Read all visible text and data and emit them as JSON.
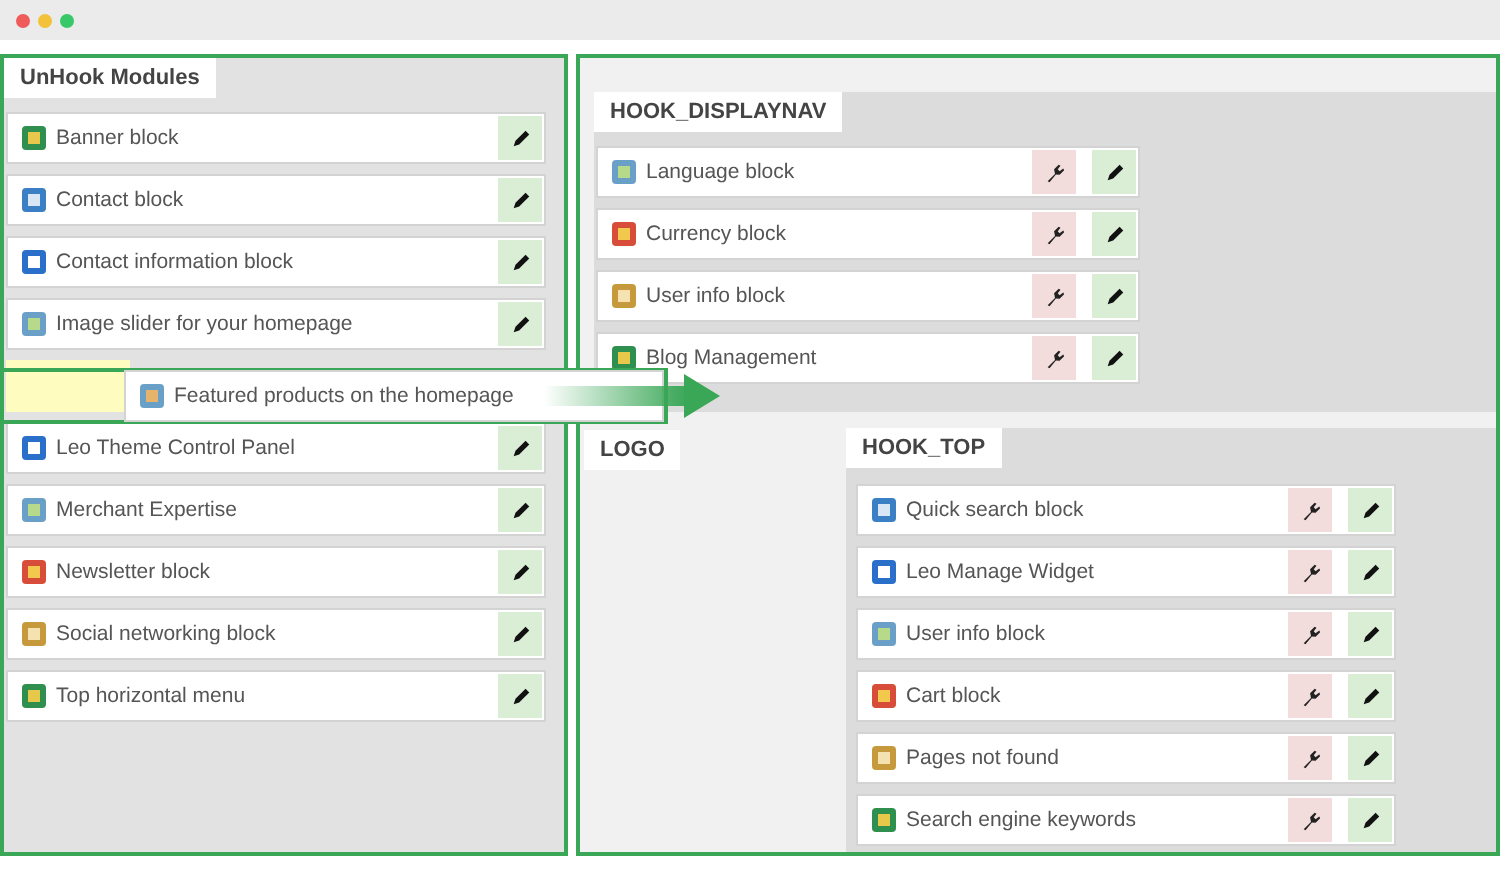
{
  "unhook_modules": {
    "title": "UnHook Modules",
    "items_before": [
      {
        "label": "Banner block"
      },
      {
        "label": "Contact block"
      },
      {
        "label": "Contact information block"
      },
      {
        "label": "Image slider for your homepage"
      }
    ],
    "dragging": {
      "label": "Featured products on the homepage"
    },
    "items_after": [
      {
        "label": "Leo Theme Control Panel"
      },
      {
        "label": "Merchant Expertise"
      },
      {
        "label": "Newsletter block"
      },
      {
        "label": "Social networking block"
      },
      {
        "label": "Top horizontal menu"
      }
    ]
  },
  "hooks": [
    {
      "title": "HOOK_DISPLAYNAV",
      "items": [
        {
          "label": "Language block"
        },
        {
          "label": "Currency block"
        },
        {
          "label": "User info block"
        },
        {
          "label": "Blog Management"
        }
      ]
    },
    {
      "title": "LOGO"
    },
    {
      "title": "HOOK_TOP",
      "items": [
        {
          "label": "Quick search block"
        },
        {
          "label": "Leo Manage Widget"
        },
        {
          "label": "User info block"
        },
        {
          "label": "Cart block"
        },
        {
          "label": "Pages not found"
        },
        {
          "label": "Search engine keywords"
        }
      ]
    }
  ]
}
